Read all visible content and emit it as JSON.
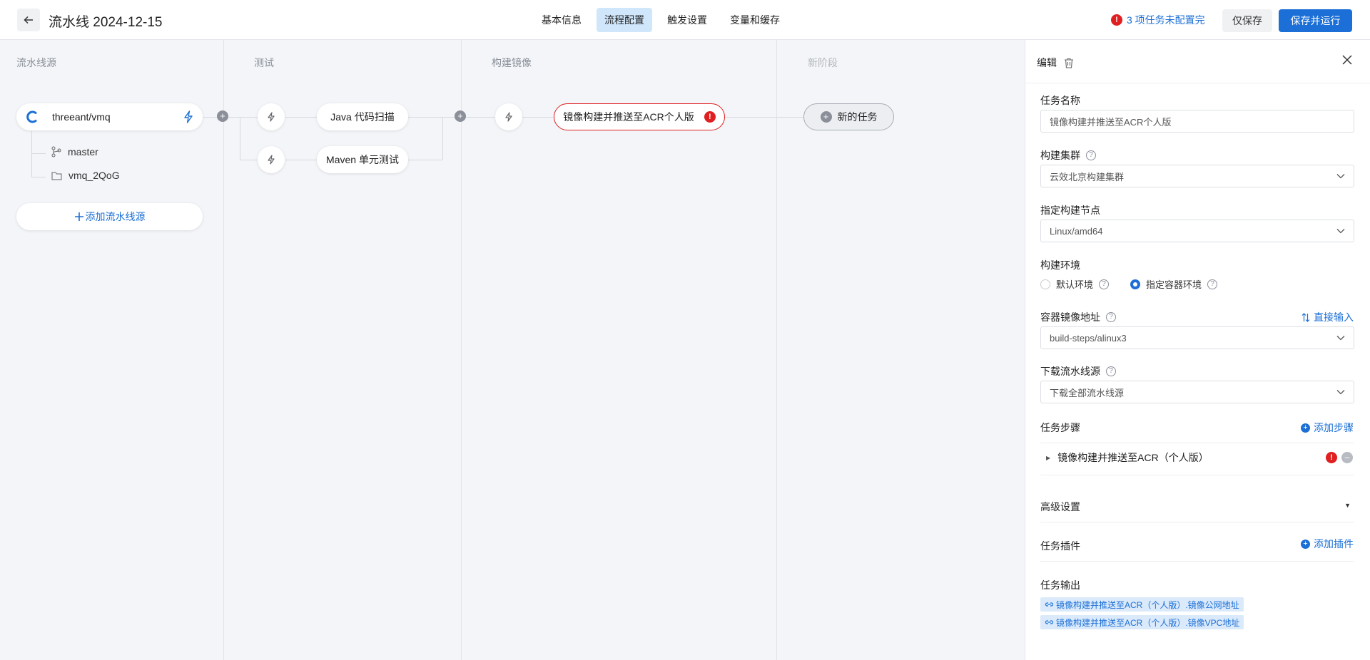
{
  "header": {
    "title": "流水线 2024-12-15",
    "tabs": [
      {
        "label": "基本信息",
        "active": false
      },
      {
        "label": "流程配置",
        "active": true
      },
      {
        "label": "触发设置",
        "active": false
      },
      {
        "label": "变量和缓存",
        "active": false
      }
    ],
    "warning": "3 项任务未配置完",
    "save_label": "仅保存",
    "run_label": "保存并运行"
  },
  "stages": [
    {
      "title": "流水线源"
    },
    {
      "title": "测试"
    },
    {
      "title": "构建镜像"
    },
    {
      "title": "新阶段"
    }
  ],
  "source": {
    "repo": "threeant/vmq",
    "branch": "master",
    "folder": "vmq_2QoG",
    "add_label": "添加流水线源"
  },
  "jobs": {
    "test": [
      "Java 代码扫描",
      "Maven 单元测试"
    ],
    "build": "镜像构建并推送至ACR个人版",
    "new_task": "新的任务"
  },
  "panel": {
    "title": "编辑",
    "task_name_label": "任务名称",
    "task_name_value": "镜像构建并推送至ACR个人版",
    "cluster_label": "构建集群",
    "cluster_value": "云效北京构建集群",
    "node_label": "指定构建节点",
    "node_value": "Linux/amd64",
    "env_label": "构建环境",
    "env_default": "默认环境",
    "env_container": "指定容器环境",
    "image_label": "容器镜像地址",
    "image_direct": "直接输入",
    "image_value": "build-steps/alinux3",
    "download_label": "下载流水线源",
    "download_value": "下载全部流水线源",
    "steps_label": "任务步骤",
    "add_step": "添加步骤",
    "step_name": "镜像构建并推送至ACR（个人版）",
    "advanced_label": "高级设置",
    "plugin_label": "任务插件",
    "add_plugin": "添加插件",
    "output_label": "任务输出",
    "outputs": [
      "镜像构建并推送至ACR（个人版）.镜像公网地址",
      "镜像构建并推送至ACR（个人版）.镜像VPC地址"
    ]
  },
  "colors": {
    "primary": "#1b6fd6",
    "error": "#e02020",
    "active_tab": "#cfe6fb"
  }
}
